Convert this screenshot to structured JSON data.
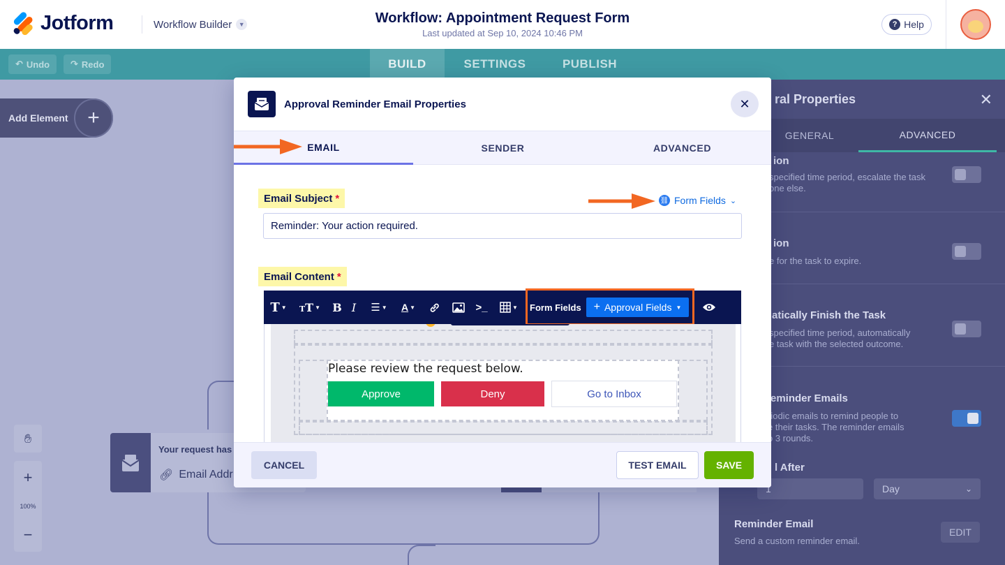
{
  "header": {
    "logo_text": "Jotform",
    "product": "Workflow Builder",
    "title": "Workflow: Appointment Request Form",
    "subtitle": "Last updated at Sep 10, 2024 10:46 PM",
    "help_label": "Help"
  },
  "navbar": {
    "undo_label": "Undo",
    "redo_label": "Redo",
    "tabs": [
      {
        "label": "BUILD",
        "active": true
      },
      {
        "label": "SETTINGS",
        "active": false
      },
      {
        "label": "PUBLISH",
        "active": false
      }
    ]
  },
  "canvas": {
    "add_element_label": "Add Element",
    "node_title": "Your request has",
    "node_field": "Email Addr",
    "zoom_level": "100%"
  },
  "right_panel": {
    "title": "ral Properties",
    "tabs": [
      {
        "label": "GENERAL",
        "active": false
      },
      {
        "label": "ADVANCED",
        "active": true
      }
    ],
    "sections": [
      {
        "heading": "ion",
        "desc": "specified time period, escalate the task\none else.",
        "toggle_on": false
      },
      {
        "heading": "ion",
        "desc": "e for the task to expire.",
        "toggle_on": false
      },
      {
        "heading": "atically Finish the Task",
        "desc": "specified time period, automatically\ne task with the selected outcome.",
        "toggle_on": false
      },
      {
        "heading": "eminder Emails",
        "desc": "riodic emails to remind people to\ne their tasks. The reminder emails\no 3 rounds.",
        "toggle_on": true
      }
    ],
    "send_after_label": "l After",
    "send_after_value": "1",
    "send_after_unit": "Day",
    "reminder_email_label": "Reminder Email",
    "reminder_email_desc": "Send a custom reminder email.",
    "edit_label": "EDIT"
  },
  "modal": {
    "title": "Approval Reminder Email Properties",
    "tabs": [
      {
        "label": "EMAIL",
        "active": true
      },
      {
        "label": "SENDER",
        "active": false
      },
      {
        "label": "ADVANCED",
        "active": false
      }
    ],
    "subject_label": "Email Subject",
    "required_mark": "*",
    "form_fields_link": "Form Fields",
    "subject_value": "Reminder: Your action required.",
    "content_label": "Email Content",
    "toolbar": {
      "form_fields": "Form Fields",
      "approval_fields": "Approval Fields"
    },
    "email_body": {
      "review_text": "Please review the request below.",
      "approve": "Approve",
      "deny": "Deny",
      "inbox": "Go to Inbox"
    },
    "footer": {
      "cancel": "CANCEL",
      "test_email": "TEST EMAIL",
      "save": "SAVE"
    }
  },
  "colors": {
    "brand_navy": "#0a1551",
    "highlight_yellow": "#fdf7a9",
    "annotation_orange": "#f26722",
    "approve_green": "#00b86b",
    "deny_red": "#d9304b",
    "save_green": "#64b200",
    "link_blue": "#0f6ae0"
  }
}
